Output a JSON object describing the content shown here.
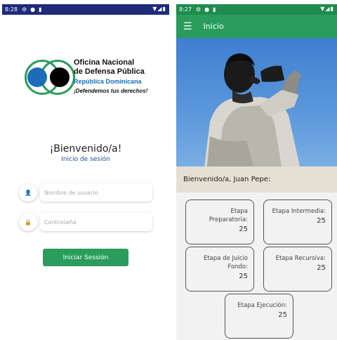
{
  "login_screen": {
    "status_time": "8:28",
    "logo": {
      "line1": "Oficina Nacional",
      "line2": "de Defensa Pública",
      "line3": "República Dominicana",
      "tagline": "¡Defendemos tus derechos!"
    },
    "welcome": "¡Bienvenido/a!",
    "subtitle": "Inicio de sesión",
    "username_placeholder": "Nombre de usuario",
    "password_placeholder": "Contraseña",
    "login_button": "Iniciar Sessión"
  },
  "home_screen": {
    "status_time": "8:27",
    "app_title": "Inicio",
    "greeting": "Bienvenido/a, Juan Pepe:",
    "cards": [
      {
        "label": "Etapa Preparatoria:",
        "value": "25"
      },
      {
        "label": "Etapa Intermedia:",
        "value": "25"
      },
      {
        "label": "Etapa de Juicio Fondo:",
        "value": "25"
      },
      {
        "label": "Etapa Recursiva:",
        "value": "25"
      },
      {
        "label": "Etapa Ejecución:",
        "value": "25"
      }
    ]
  },
  "colors": {
    "brand_green": "#2a9d5c",
    "status_bar_navy": "#1e2a7a",
    "status_bar_green": "#1f8c4e",
    "logo_blue": "#1d6cb7",
    "greeting_band": "#e6dfd3"
  },
  "icons": [
    "settings-icon",
    "shield-icon",
    "sd-card-icon",
    "wifi-icon",
    "signal-icon",
    "battery-icon",
    "menu-icon",
    "user-icon",
    "lock-icon"
  ]
}
